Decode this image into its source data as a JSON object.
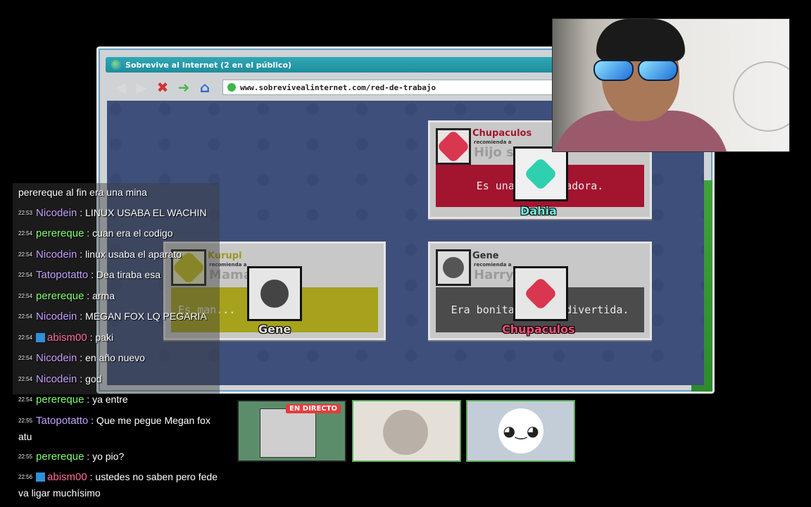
{
  "game": {
    "title": "Sobrevive al Internet  (2 en el público)",
    "url": "www.sobrevivealinternet.com/red-de-trabajo",
    "cards": [
      {
        "recommender": "Chupaculos",
        "recommends": "recomienda a",
        "target": "Hijo sa...",
        "quote": "Es una an...ntadora.",
        "player": "Dahia"
      },
      {
        "recommender": "Kurupi",
        "recommends": "recomienda a",
        "target": "Mamá ... ca",
        "quote": "Es man...",
        "player": "Gene"
      },
      {
        "recommender": "Gene",
        "recommends": "recomienda a",
        "target": "Harry ... Jr.",
        "quote": "Era bonita,  ...  y divertida.",
        "player": "Chupaculos"
      }
    ]
  },
  "chat": {
    "messages": [
      {
        "time": "",
        "user": "",
        "text": "perereque al fin era una mina",
        "color": ""
      },
      {
        "time": "22:53",
        "user": "Nicodein",
        "text": " : LINUX USABA EL WACHIN",
        "color": "purple"
      },
      {
        "time": "22:54",
        "user": "perereque",
        "text": " : cuan era el codigo",
        "color": "green"
      },
      {
        "time": "22:54",
        "user": "Nicodein",
        "text": " : linux usaba el aparato",
        "color": "purple"
      },
      {
        "time": "22:54",
        "user": "Tatopotatto",
        "text": " : Dea tiraba esa",
        "color": "lav"
      },
      {
        "time": "22:54",
        "user": "perereque",
        "text": " : arma",
        "color": "green"
      },
      {
        "time": "22:54",
        "user": "Nicodein",
        "text": " : MEGAN FOX LQ PEGARIA",
        "color": "purple"
      },
      {
        "time": "22:54",
        "user": "abism00",
        "text": " : paki",
        "color": "pink",
        "badge": true
      },
      {
        "time": "22:54",
        "user": "Nicodein",
        "text": " : en año nuevo",
        "color": "purple"
      },
      {
        "time": "22:54",
        "user": "Nicodein",
        "text": " : god",
        "color": "purple"
      },
      {
        "time": "22:54",
        "user": "perereque",
        "text": " : ya entre",
        "color": "green"
      },
      {
        "time": "22:55",
        "user": "Tatopotatto",
        "text": " : Que me pegue Megan fox atu",
        "color": "lav"
      },
      {
        "time": "22:55",
        "user": "perereque",
        "text": " : yo pio?",
        "color": "green"
      },
      {
        "time": "22:56",
        "user": "abism00",
        "text": " : ustedes no saben pero fede va ligar muchísimo",
        "color": "pink",
        "badge": true
      }
    ]
  },
  "thumbs": {
    "live_label": "EN DIRECTO"
  }
}
